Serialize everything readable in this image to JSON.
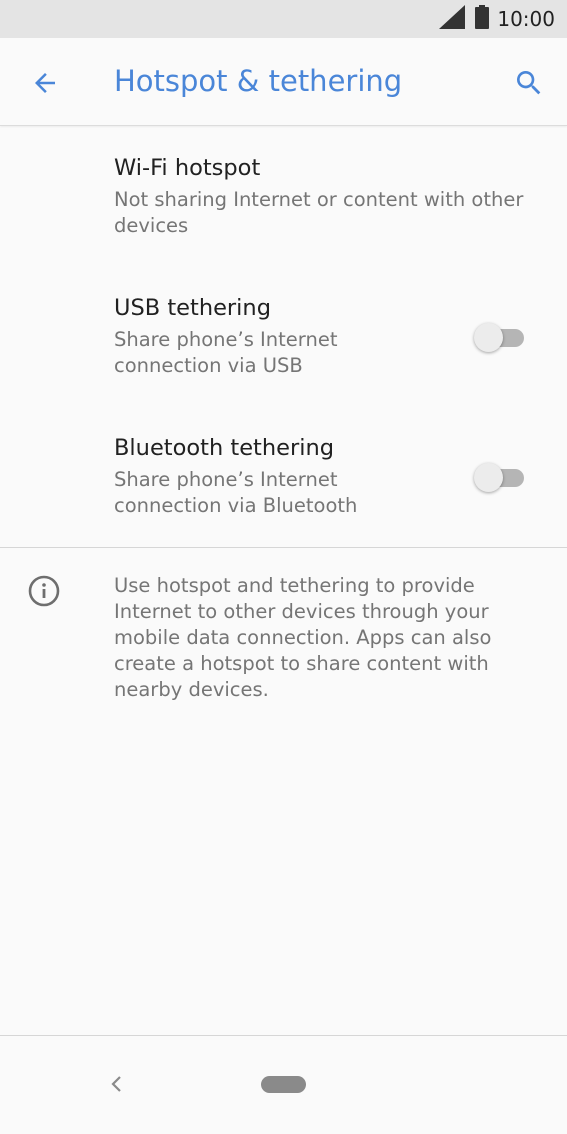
{
  "status_bar": {
    "time": "10:00",
    "icons": [
      "signal-icon",
      "battery-icon"
    ]
  },
  "app_bar": {
    "title": "Hotspot & tethering",
    "back_icon": "arrow-back-icon",
    "search_icon": "search-icon",
    "accent_color": "#4a86d8"
  },
  "preferences": [
    {
      "title": "Wi-Fi hotspot",
      "summary_lines": [
        "Not sharing Internet or content with other",
        "devices"
      ],
      "has_switch": false
    },
    {
      "title": "USB tethering",
      "summary_lines": [
        "Share phone’s Internet",
        "connection via USB"
      ],
      "has_switch": true,
      "switch_on": false
    },
    {
      "title": "Bluetooth tethering",
      "summary_lines": [
        "Share phone’s Internet",
        "connection via Bluetooth"
      ],
      "has_switch": true,
      "switch_on": false
    }
  ],
  "info": {
    "icon": "info-icon",
    "lines": [
      "Use hotspot and tethering to provide",
      "Internet to other devices through your",
      "mobile data connection. Apps can also",
      "create a hotspot to share content with",
      "nearby devices."
    ]
  },
  "nav_bar": {
    "icons": [
      "nav-back-icon",
      "home-pill-icon"
    ]
  }
}
